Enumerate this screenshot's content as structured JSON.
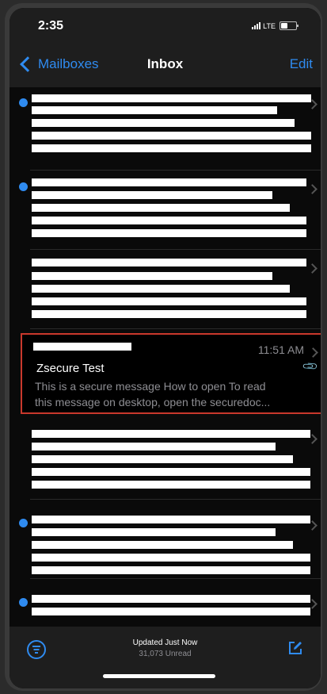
{
  "status": {
    "time": "2:35",
    "network": "LTE"
  },
  "nav": {
    "back_label": "Mailboxes",
    "title": "Inbox",
    "edit_label": "Edit"
  },
  "highlighted_message": {
    "time": "11:51 AM",
    "subject": "Zsecure Test",
    "preview_line1": "This is a secure message How to open To read",
    "preview_line2": "this message on desktop, open the securedoc..."
  },
  "footer": {
    "updated": "Updated Just Now",
    "unread": "31,073 Unread"
  },
  "colors": {
    "accent": "#2f8bf0",
    "highlight_border": "#c9382c"
  },
  "icons": [
    "chevron-left-icon",
    "chevron-right-icon",
    "unread-dot-icon",
    "paperclip-icon",
    "filter-icon",
    "compose-icon"
  ]
}
